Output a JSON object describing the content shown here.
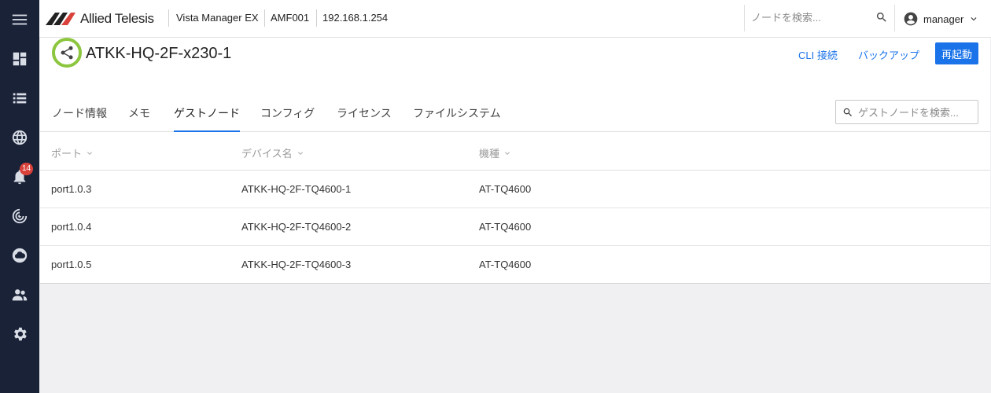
{
  "header": {
    "brand": "Allied Telesis",
    "product": "Vista Manager EX",
    "area": "AMF001",
    "ip": "192.168.1.254",
    "search_placeholder": "ノードを検索...",
    "user": "manager"
  },
  "sidebar": {
    "notification_count": "14",
    "items": [
      "menu-icon",
      "dashboard-icon",
      "list-icon",
      "globe-icon",
      "bell-icon",
      "radar-icon",
      "cloud-icon",
      "people-icon",
      "gear-icon"
    ]
  },
  "node": {
    "title": "ATKK-HQ-2F-x230-1",
    "actions": {
      "cli": "CLI 接続",
      "backup": "バックアップ",
      "reboot": "再起動"
    }
  },
  "tabs": [
    "ノード情報",
    "メモ",
    "ゲストノード",
    "コンフィグ",
    "ライセンス",
    "ファイルシステム"
  ],
  "active_tab": "ゲストノード",
  "guest_search_placeholder": "ゲストノードを検索...",
  "table": {
    "columns": [
      "ポート",
      "デバイス名",
      "機種"
    ],
    "rows": [
      [
        "port1.0.3",
        "ATKK-HQ-2F-TQ4600-1",
        "AT-TQ4600"
      ],
      [
        "port1.0.4",
        "ATKK-HQ-2F-TQ4600-2",
        "AT-TQ4600"
      ],
      [
        "port1.0.5",
        "ATKK-HQ-2F-TQ4600-3",
        "AT-TQ4600"
      ]
    ]
  },
  "colors": {
    "sidebar": "#1a2238",
    "accent": "#1a73e8",
    "node_ring": "#8cc63f",
    "badge": "#d9413a"
  }
}
